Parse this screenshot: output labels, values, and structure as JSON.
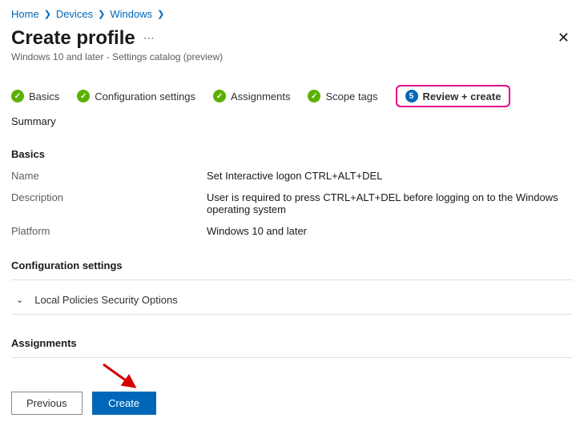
{
  "breadcrumb": {
    "home": "Home",
    "devices": "Devices",
    "windows": "Windows"
  },
  "title": "Create profile",
  "subtitle": "Windows 10 and later - Settings catalog (preview)",
  "steps": {
    "basics": "Basics",
    "config": "Configuration settings",
    "assign": "Assignments",
    "scope": "Scope tags",
    "review_num": "5",
    "review": "Review + create"
  },
  "summary_label": "Summary",
  "basics_heading": "Basics",
  "fields": {
    "name_label": "Name",
    "name_value": "Set Interactive logon CTRL+ALT+DEL",
    "desc_label": "Description",
    "desc_value": "User is required to press CTRL+ALT+DEL before logging on to the Windows operating system",
    "platform_label": "Platform",
    "platform_value": "Windows 10 and later"
  },
  "config_heading": "Configuration settings",
  "config_item": "Local Policies Security Options",
  "assignments_heading": "Assignments",
  "buttons": {
    "prev": "Previous",
    "create": "Create"
  }
}
